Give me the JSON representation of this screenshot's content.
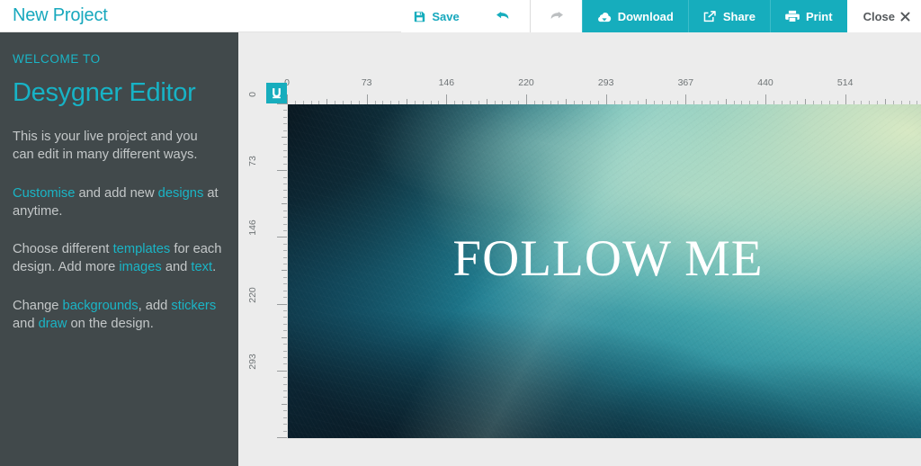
{
  "header": {
    "project_title": "New Project",
    "buttons": [
      {
        "key": "save",
        "label": "Save",
        "icon": "floppy-disk-icon",
        "style": "plain-teal"
      },
      {
        "key": "undo",
        "label": "",
        "icon": "undo-arrow-icon",
        "style": "plain-teal"
      },
      {
        "key": "redo",
        "label": "",
        "icon": "redo-arrow-icon",
        "style": "disabled"
      },
      {
        "key": "download",
        "label": "Download",
        "icon": "cloud-download-icon",
        "style": "teal-filled"
      },
      {
        "key": "share",
        "label": "Share",
        "icon": "share-icon",
        "style": "teal-filled"
      },
      {
        "key": "print",
        "label": "Print",
        "icon": "printer-icon",
        "style": "teal-filled"
      },
      {
        "key": "close",
        "label": "Close",
        "icon": "close-x-icon",
        "style": "plain-grey"
      }
    ]
  },
  "sidebar": {
    "kicker": "WELCOME TO",
    "brand": "Desygner Editor",
    "paragraphs": [
      {
        "parts": [
          {
            "text": "This is your live project and you can edit in many different ways.",
            "link": false
          }
        ]
      },
      {
        "parts": [
          {
            "text": "Customise",
            "link": true
          },
          {
            "text": " and add new ",
            "link": false
          },
          {
            "text": "designs",
            "link": true
          },
          {
            "text": " at anytime.",
            "link": false
          }
        ]
      },
      {
        "parts": [
          {
            "text": "Choose different ",
            "link": false
          },
          {
            "text": "templates",
            "link": true
          },
          {
            "text": " for each design. Add more ",
            "link": false
          },
          {
            "text": "images",
            "link": true
          },
          {
            "text": " and ",
            "link": false
          },
          {
            "text": "text",
            "link": true
          },
          {
            "text": ".",
            "link": false
          }
        ]
      },
      {
        "parts": [
          {
            "text": "Change ",
            "link": false
          },
          {
            "text": "backgrounds",
            "link": true
          },
          {
            "text": ", add ",
            "link": false
          },
          {
            "text": "stickers",
            "link": true
          },
          {
            "text": " and ",
            "link": false
          },
          {
            "text": "draw",
            "link": true
          },
          {
            "text": " on the design.",
            "link": false
          }
        ]
      }
    ]
  },
  "workspace": {
    "ruler_corner_icon": "desygner-logo-icon",
    "ruler_horizontal": {
      "labels": [
        "0",
        "73",
        "146",
        "220",
        "293",
        "367",
        "440",
        "514"
      ],
      "unit_step": 73,
      "max": 587
    },
    "ruler_vertical": {
      "labels": [
        "0",
        "73",
        "146",
        "220",
        "293"
      ],
      "unit_step": 73,
      "max": 366
    },
    "canvas": {
      "text": "FOLLOW ME",
      "text_color": "#ffffff"
    }
  },
  "colors": {
    "accent_teal": "#16adbd",
    "link_teal": "#1ab5c6",
    "sidebar_bg": "#41494b",
    "workspace_bg": "#ececec",
    "header_bg": "#ffffff",
    "close_text": "#55595c"
  }
}
